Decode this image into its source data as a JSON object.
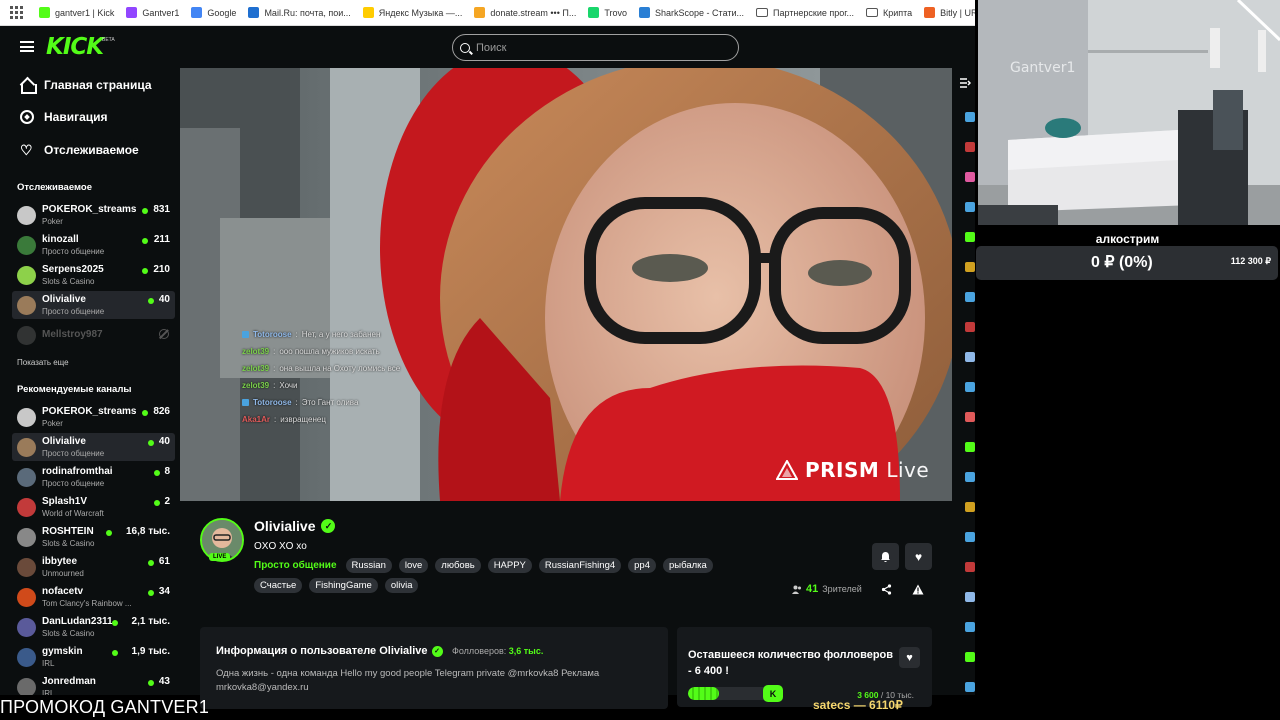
{
  "bookmarks": [
    {
      "label": "gantver1 | Kick",
      "color": "#53fc18"
    },
    {
      "label": "Gantver1",
      "color": "#9146ff"
    },
    {
      "label": "Google",
      "color": "#4285f4"
    },
    {
      "label": "Mail.Ru: почта, пои...",
      "color": "#1f6fd0"
    },
    {
      "label": "Яндекс Музыка —...",
      "color": "#ffcc00"
    },
    {
      "label": "donate.stream ••• П...",
      "color": "#f5a623"
    },
    {
      "label": "Trovo",
      "color": "#19d66b"
    },
    {
      "label": "SharkScope - Стати...",
      "color": "#2a7fd4"
    },
    {
      "label": "Партнерские прог...",
      "color": "folder"
    },
    {
      "label": "Крипта",
      "color": "folder"
    },
    {
      "label": "Bitly | URL Shortene",
      "color": "#ee6123"
    }
  ],
  "search": {
    "placeholder": "Поиск"
  },
  "logo": {
    "text": "KICK",
    "beta": "BETA"
  },
  "nav": {
    "home": "Главная страница",
    "browse": "Навигация",
    "following": "Отслеживаемое"
  },
  "following_section": {
    "title": "Отслеживаемое",
    "channels": [
      {
        "name": "POKEROK_streams",
        "category": "Poker",
        "viewers": "831",
        "avatar": "#c8c8c8"
      },
      {
        "name": "kinozall",
        "category": "Просто общение",
        "viewers": "211",
        "avatar": "#3a7a3a"
      },
      {
        "name": "Serpens2025",
        "category": "Slots & Casino",
        "viewers": "210",
        "avatar": "#8dd14a"
      },
      {
        "name": "Olivialive",
        "category": "Просто общение",
        "viewers": "40",
        "avatar": "#9a7b5a"
      }
    ],
    "offline": {
      "name": "Mellstroy987"
    },
    "show_more": "Показать еще"
  },
  "recommended_section": {
    "title": "Рекомендуемые каналы",
    "channels": [
      {
        "name": "POKEROK_streams",
        "category": "Poker",
        "viewers": "826",
        "avatar": "#c8c8c8"
      },
      {
        "name": "Olivialive",
        "category": "Просто общение",
        "viewers": "40",
        "avatar": "#9a7b5a"
      },
      {
        "name": "rodinafromthai",
        "category": "Просто общение",
        "viewers": "8",
        "avatar": "#5a6a7a"
      },
      {
        "name": "Splash1V",
        "category": "World of Warcraft",
        "viewers": "2",
        "avatar": "#c23a3a"
      },
      {
        "name": "ROSHTEIN",
        "category": "Slots & Casino",
        "viewers": "16,8 тыс.",
        "avatar": "#888888"
      },
      {
        "name": "ibbytee",
        "category": "Unmourned",
        "viewers": "61",
        "avatar": "#6a4a3a"
      },
      {
        "name": "nofacetv",
        "category": "Tom Clancy's Rainbow ...",
        "viewers": "34",
        "avatar": "#d04a1a"
      },
      {
        "name": "DanLudan2311",
        "category": "Slots & Casino",
        "viewers": "2,1 тыс.",
        "avatar": "#5a5a9a"
      },
      {
        "name": "gymskin",
        "category": "IRL",
        "viewers": "1,9 тыс.",
        "avatar": "#3a5a8a"
      },
      {
        "name": "Jonredman",
        "category": "IRL",
        "viewers": "43",
        "avatar": "#6a6a6a"
      }
    ]
  },
  "video": {
    "chat": [
      {
        "user": "Totoroose",
        "mod": true,
        "color": "#8fb8e8",
        "text": "Нет, а у него забанен"
      },
      {
        "user": "zelot39",
        "mod": false,
        "color": "#7ad04a",
        "text": "ооо пошла мужиков искать"
      },
      {
        "user": "zelot39",
        "mod": false,
        "color": "#7ad04a",
        "text": "она вышла на Охоту ломись все"
      },
      {
        "user": "zelot39",
        "mod": false,
        "color": "#7ad04a",
        "text": "Хочи"
      },
      {
        "user": "Totoroose",
        "mod": true,
        "color": "#8fb8e8",
        "text": "Это Гант олива"
      },
      {
        "user": "Aka1Ar",
        "mod": false,
        "color": "#e05a5a",
        "text": "извращенец"
      }
    ],
    "watermark_a": "PRISM",
    "watermark_b": "Live"
  },
  "stream": {
    "streamer": "Olivialive",
    "live_badge": "LIVE",
    "title": "OXO XO xo",
    "category": "Просто общение",
    "tags": [
      "Russian",
      "love",
      "любовь",
      "HAPPY",
      "RussianFishing4",
      "pp4",
      "рыбалка",
      "Счастье",
      "FishingGame",
      "olivia"
    ],
    "viewers": "41",
    "viewers_label": "Зрителей"
  },
  "about": {
    "title": "Информация о пользователе Olivialive",
    "followers_label": "Фолловеров:",
    "followers_value": "3,6 тыс.",
    "bio": "Одна жизнь - одна команда Hello my good people   Telegram private @mrkovka8 Реклама mrkovka8@yandex.ru"
  },
  "goal": {
    "title": "Оставшееся количество фолловеров - 6 400 !",
    "current": "3 600",
    "target": "/ 10 тыс.",
    "progress": 0.36
  },
  "donation": {
    "title": "алкострим",
    "amount": "0 ₽ (0%)",
    "goal": "112 300 ₽"
  },
  "bottom": {
    "promo": "ПРОМОКОД GANTVER1",
    "last_donation": "satecs — 6110₽"
  },
  "webcam": {
    "wall_text": "Gantver1"
  },
  "colors": {
    "accent": "#53fc18",
    "bg": "#0b0e0f",
    "panel": "#16191c"
  }
}
